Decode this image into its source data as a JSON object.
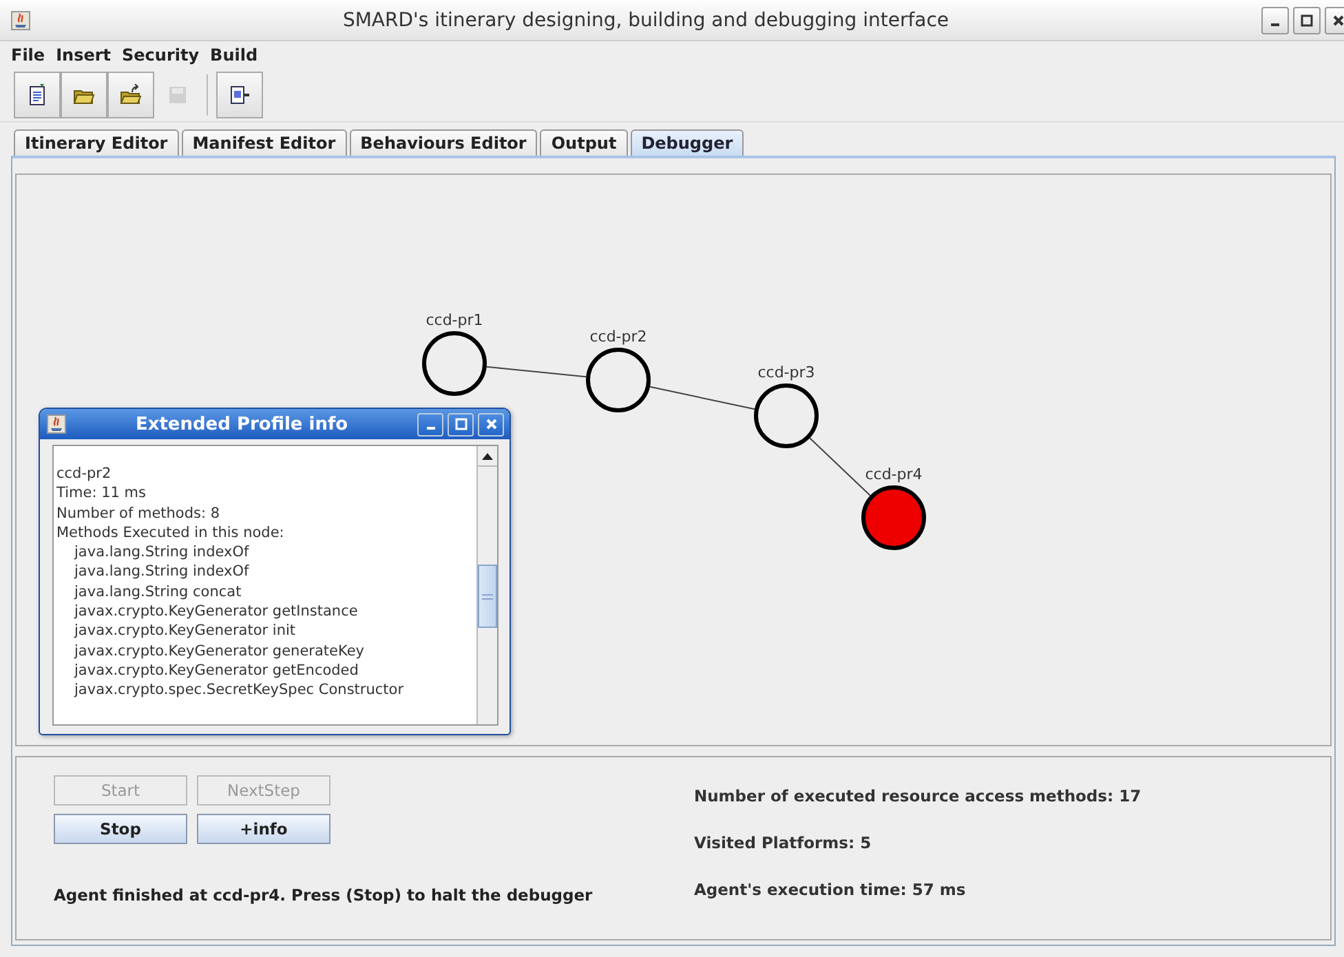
{
  "window": {
    "title": "SMARD's itinerary designing, building and debugging interface"
  },
  "menu": [
    "File",
    "Insert",
    "Security",
    "Build"
  ],
  "toolbar": [
    {
      "kind": "new",
      "disabled": false
    },
    {
      "kind": "open",
      "disabled": false
    },
    {
      "kind": "open-up",
      "disabled": false
    },
    {
      "kind": "save",
      "disabled": true
    },
    {
      "kind": "export",
      "disabled": false
    }
  ],
  "tabs": [
    {
      "label": "Itinerary Editor",
      "selected": false
    },
    {
      "label": "Manifest Editor",
      "selected": false
    },
    {
      "label": "Behaviours Editor",
      "selected": false
    },
    {
      "label": "Output",
      "selected": false
    },
    {
      "label": "Debugger",
      "selected": true
    }
  ],
  "graph": {
    "nodes": [
      {
        "label": "ccd-pr1",
        "active": false
      },
      {
        "label": "ccd-pr2",
        "active": false
      },
      {
        "label": "ccd-pr3",
        "active": false
      },
      {
        "label": "ccd-pr4",
        "active": true
      }
    ]
  },
  "dialog": {
    "title": "Extended Profile info",
    "lines": [
      {
        "kind": "info",
        "text": "ccd-pr2"
      },
      {
        "kind": "info",
        "text": "Time: 11 ms"
      },
      {
        "kind": "info",
        "text": "Number of methods: 8"
      },
      {
        "kind": "info",
        "text": "Methods Executed in this node:"
      },
      {
        "kind": "method",
        "text": "java.lang.String indexOf"
      },
      {
        "kind": "method",
        "text": "java.lang.String indexOf"
      },
      {
        "kind": "method",
        "text": "java.lang.String concat"
      },
      {
        "kind": "method",
        "text": "javax.crypto.KeyGenerator getInstance"
      },
      {
        "kind": "method",
        "text": "javax.crypto.KeyGenerator init"
      },
      {
        "kind": "method",
        "text": "javax.crypto.KeyGenerator generateKey"
      },
      {
        "kind": "method",
        "text": "javax.crypto.KeyGenerator getEncoded"
      },
      {
        "kind": "method",
        "text": "javax.crypto.spec.SecretKeySpec Constructor"
      }
    ]
  },
  "controls": {
    "buttons": [
      {
        "label": "Start",
        "disabled": true
      },
      {
        "label": "NextStep",
        "disabled": true
      },
      {
        "label": "Stop",
        "disabled": false
      },
      {
        "label": "+info",
        "disabled": false
      }
    ],
    "status": "Agent finished at ccd-pr4. Press (Stop) to halt the debugger"
  },
  "stats": [
    "Number of executed resource access methods: 17",
    "Visited Platforms: 5",
    "Agent's execution time: 57 ms"
  ]
}
